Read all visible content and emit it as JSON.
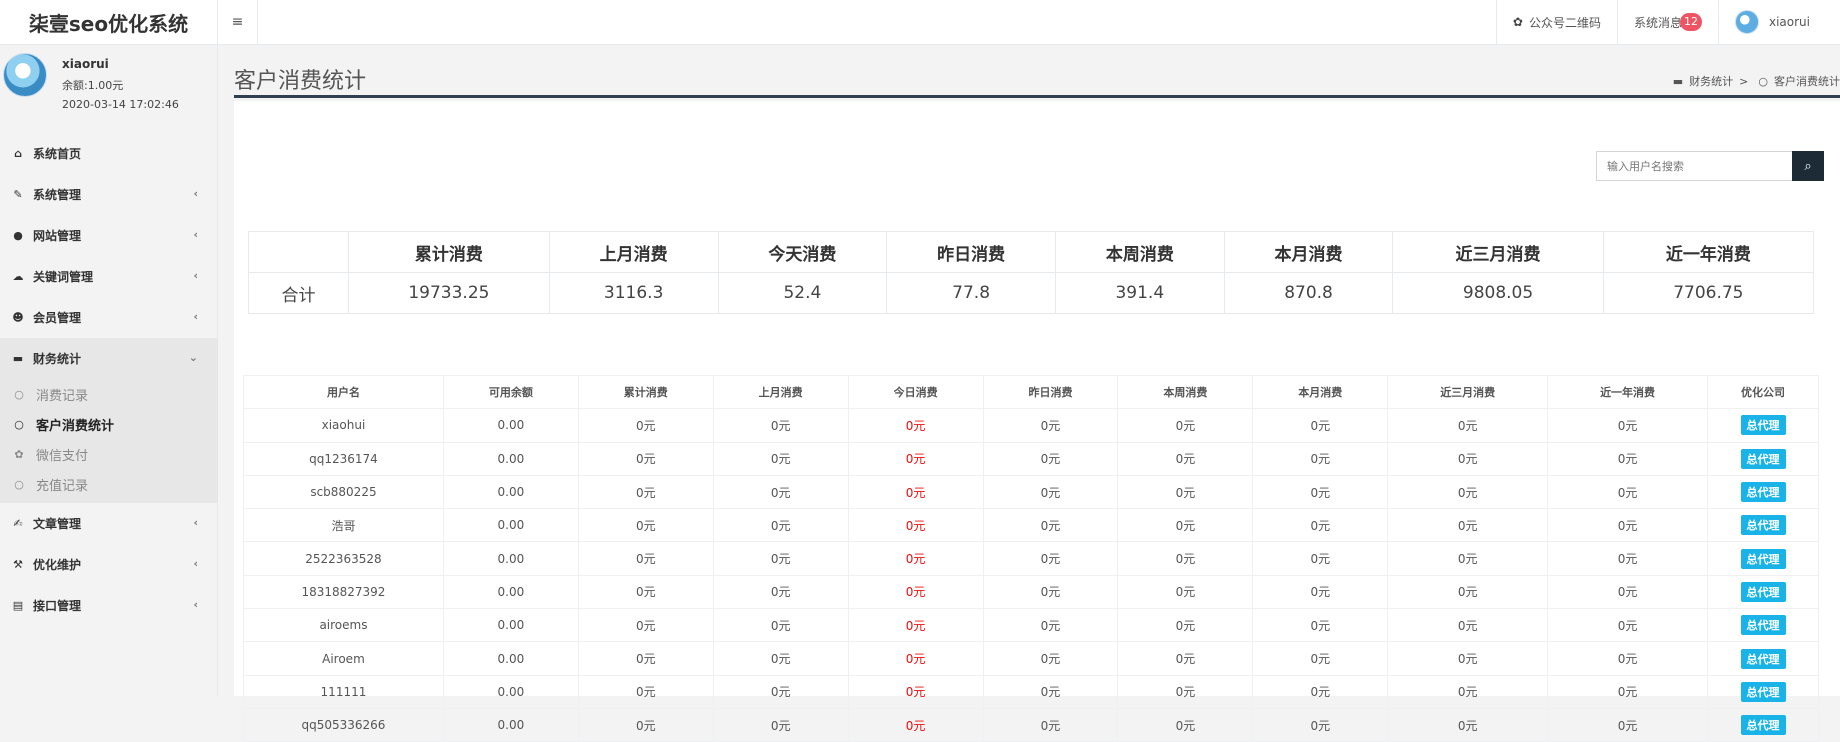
{
  "app": {
    "title": "柒壹seo优化系统"
  },
  "topbar": {
    "qrcode": "公众号二维码",
    "messages": "系统消息",
    "message_count": "12",
    "username": "xiaorui"
  },
  "profile": {
    "name": "xiaorui",
    "balance": "余额:1.00元",
    "time": "2020-03-14 17:02:46"
  },
  "nav": [
    {
      "label": "系统首页",
      "icon": "home-icon"
    },
    {
      "label": "系统管理",
      "icon": "wrench-icon"
    },
    {
      "label": "网站管理",
      "icon": "circle-icon"
    },
    {
      "label": "关键词管理",
      "icon": "cloud-icon"
    },
    {
      "label": "会员管理",
      "icon": "users-icon"
    },
    {
      "label": "财务统计",
      "icon": "card-icon"
    },
    {
      "label": "文章管理",
      "icon": "edit-icon"
    },
    {
      "label": "优化维护",
      "icon": "gavel-icon"
    },
    {
      "label": "接口管理",
      "icon": "book-icon"
    }
  ],
  "subnav": [
    {
      "label": "消费记录",
      "icon": "circle-icon"
    },
    {
      "label": "客户消费统计",
      "icon": "circle-icon"
    },
    {
      "label": "微信支付",
      "icon": "wechat-icon"
    },
    {
      "label": "充值记录",
      "icon": "circle-icon"
    }
  ],
  "page": {
    "title": "客户消费统计",
    "crumb1": "财务统计",
    "crumb_sep": ">",
    "crumb2": "客户消费统计"
  },
  "search": {
    "placeholder": "输入用户名搜索"
  },
  "summary": {
    "headers": [
      "累计消费",
      "上月消费",
      "今天消费",
      "昨日消费",
      "本周消费",
      "本月消费",
      "近三月消费",
      "近一年消费"
    ],
    "row_label": "合计",
    "values": [
      "19733.25",
      "3116.3",
      "52.4",
      "77.8",
      "391.4",
      "870.8",
      "9808.05",
      "7706.75"
    ]
  },
  "table": {
    "headers": [
      "用户名",
      "可用余额",
      "累计消费",
      "上月消费",
      "今日消费",
      "昨日消费",
      "本周消费",
      "本月消费",
      "近三月消费",
      "近一年消费",
      "优化公司"
    ],
    "rows": [
      [
        "xiaohui",
        "0.00",
        "0元",
        "0元",
        "0元",
        "0元",
        "0元",
        "0元",
        "0元",
        "0元",
        "总代理"
      ],
      [
        "qq1236174",
        "0.00",
        "0元",
        "0元",
        "0元",
        "0元",
        "0元",
        "0元",
        "0元",
        "0元",
        "总代理"
      ],
      [
        "scb880225",
        "0.00",
        "0元",
        "0元",
        "0元",
        "0元",
        "0元",
        "0元",
        "0元",
        "0元",
        "总代理"
      ],
      [
        "浩哥",
        "0.00",
        "0元",
        "0元",
        "0元",
        "0元",
        "0元",
        "0元",
        "0元",
        "0元",
        "总代理"
      ],
      [
        "2522363528",
        "0.00",
        "0元",
        "0元",
        "0元",
        "0元",
        "0元",
        "0元",
        "0元",
        "0元",
        "总代理"
      ],
      [
        "18318827392",
        "0.00",
        "0元",
        "0元",
        "0元",
        "0元",
        "0元",
        "0元",
        "0元",
        "0元",
        "总代理"
      ],
      [
        "airoems",
        "0.00",
        "0元",
        "0元",
        "0元",
        "0元",
        "0元",
        "0元",
        "0元",
        "0元",
        "总代理"
      ],
      [
        "Airoem",
        "0.00",
        "0元",
        "0元",
        "0元",
        "0元",
        "0元",
        "0元",
        "0元",
        "0元",
        "总代理"
      ],
      [
        "111111",
        "0.00",
        "0元",
        "0元",
        "0元",
        "0元",
        "0元",
        "0元",
        "0元",
        "0元",
        "总代理"
      ],
      [
        "qq505336266",
        "0.00",
        "0元",
        "0元",
        "0元",
        "0元",
        "0元",
        "0元",
        "0元",
        "0元",
        "总代理"
      ]
    ]
  },
  "colors": {
    "today_value": "#ed0c0c",
    "tag_bg": "#1ab3e8",
    "head_rule": "#2f4050"
  }
}
